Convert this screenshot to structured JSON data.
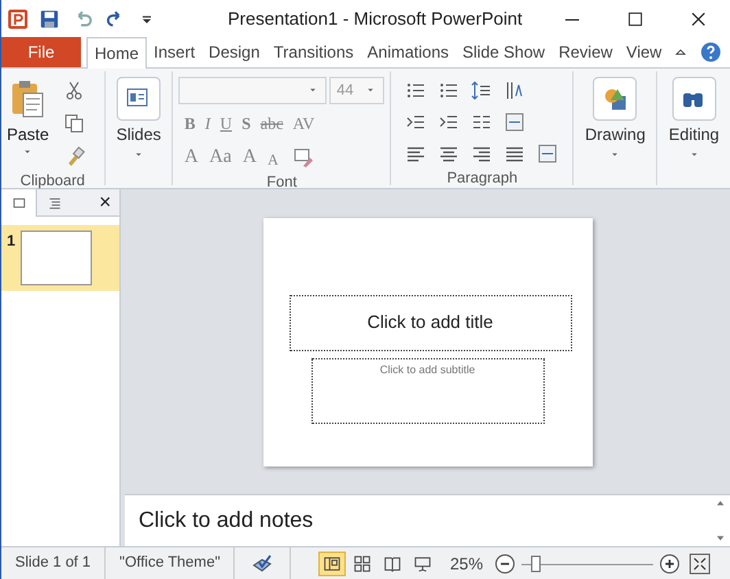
{
  "window": {
    "title": "Presentation1  -  Microsoft PowerPoint"
  },
  "tabs": [
    {
      "label": "File",
      "kind": "file",
      "selected": false
    },
    {
      "label": "Home",
      "kind": "tab",
      "selected": true
    },
    {
      "label": "Insert",
      "kind": "tab",
      "selected": false
    },
    {
      "label": "Design",
      "kind": "tab",
      "selected": false
    },
    {
      "label": "Transitions",
      "kind": "tab",
      "selected": false
    },
    {
      "label": "Animations",
      "kind": "tab",
      "selected": false
    },
    {
      "label": "Slide Show",
      "kind": "tab",
      "selected": false
    },
    {
      "label": "Review",
      "kind": "tab",
      "selected": false
    },
    {
      "label": "View",
      "kind": "tab",
      "selected": false
    }
  ],
  "ribbon": {
    "clipboard": {
      "label": "Clipboard",
      "paste": "Paste"
    },
    "slides": {
      "button": "Slides"
    },
    "font": {
      "label": "Font",
      "font_size": "44",
      "row1": [
        "B",
        "I",
        "U",
        "S",
        "abc",
        "AV"
      ],
      "row2": [
        "A",
        "Aa",
        "A",
        "A"
      ]
    },
    "paragraph": {
      "label": "Paragraph"
    },
    "drawing": {
      "button": "Drawing"
    },
    "editing": {
      "button": "Editing"
    }
  },
  "thumbnail_pane": {
    "close": "×",
    "tabs": [
      {
        "kind": "slides",
        "selected": true
      },
      {
        "kind": "outline",
        "selected": false
      }
    ],
    "slides": [
      {
        "number": "1",
        "selected": true
      }
    ]
  },
  "slide": {
    "title_placeholder": "Click to add title",
    "subtitle_placeholder": "Click to add subtitle"
  },
  "notes": {
    "placeholder": "Click to add notes"
  },
  "status_bar": {
    "slide": "Slide 1 of 1",
    "theme": "\"Office Theme\"",
    "views": [
      {
        "kind": "normal",
        "selected": true
      },
      {
        "kind": "sorter",
        "selected": false
      },
      {
        "kind": "reading",
        "selected": false
      },
      {
        "kind": "show",
        "selected": false
      }
    ],
    "zoom": "25%",
    "zoom_slider": {
      "level": 0.1
    }
  }
}
